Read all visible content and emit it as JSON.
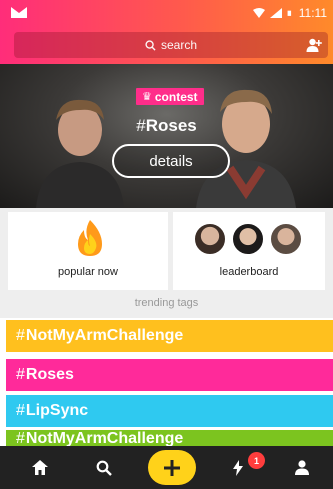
{
  "status_bar": {
    "time": "11:11"
  },
  "search": {
    "placeholder": "search"
  },
  "hero": {
    "badge_label": "contest",
    "hashtag": "Roses",
    "details_label": "details"
  },
  "cards": {
    "popular_label": "popular now",
    "leaderboard_label": "leaderboard"
  },
  "trending": {
    "section_label": "trending tags",
    "tags": [
      {
        "name": "NotMyArmChallenge",
        "color": "#ffc01e"
      },
      {
        "name": "Roses",
        "color": "#ff2a9a"
      },
      {
        "name": "LipSync",
        "color": "#2fc9f0"
      },
      {
        "name": "NotMyArmChallenge",
        "color": "#7cc41f"
      }
    ]
  },
  "nav": {
    "items": [
      "home-icon",
      "search-icon",
      "plus-icon",
      "lightning-icon",
      "profile-icon"
    ],
    "notification_count": "1"
  },
  "colors": {
    "header_gradient_start": "#ff2d7a",
    "header_gradient_end": "#ff8a2a",
    "contest_badge": "#ff2d8a",
    "plus_button": "#ffd21a",
    "nav_background": "#222222",
    "badge": "#ff3d3d"
  }
}
